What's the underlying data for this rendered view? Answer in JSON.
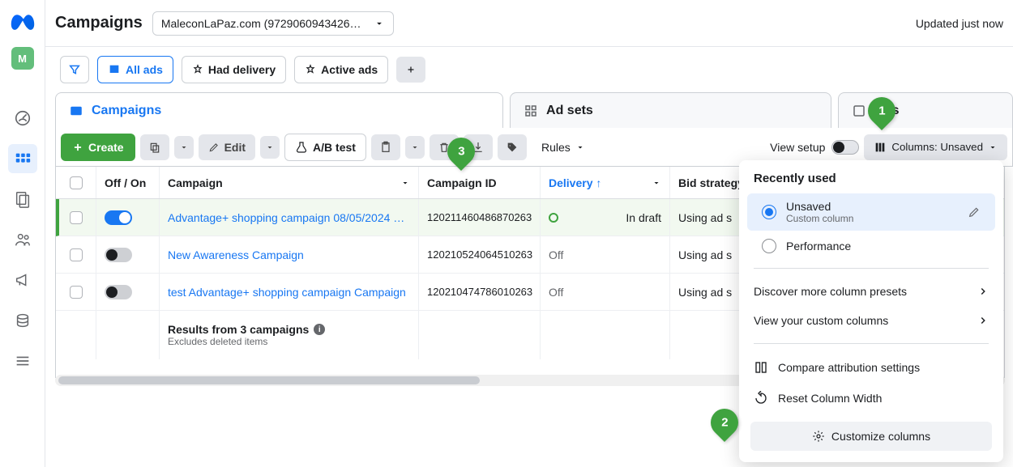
{
  "header": {
    "title": "Campaigns",
    "account": "MaleconLaPaz.com (9729060943426…",
    "updated": "Updated just now"
  },
  "avatar_letter": "M",
  "filters": {
    "all_ads": "All ads",
    "had_delivery": "Had delivery",
    "active_ads": "Active ads"
  },
  "tabs": {
    "campaigns": "Campaigns",
    "adsets": "Ad sets",
    "ads": "Ads"
  },
  "toolbar": {
    "create": "Create",
    "edit": "Edit",
    "abtest": "A/B test",
    "rules": "Rules",
    "view_setup": "View setup",
    "columns": "Columns: Unsaved"
  },
  "columns": {
    "onoff": "Off / On",
    "campaign": "Campaign",
    "campaign_id": "Campaign ID",
    "delivery": "Delivery",
    "bid": "Bid strategy"
  },
  "rows": [
    {
      "on": true,
      "name": "Advantage+ shopping campaign 08/05/2024 …",
      "id": "120211460486870263",
      "delivery": "In draft",
      "delivery_status": "draft",
      "bid": "Using ad s",
      "highlight": true
    },
    {
      "on": false,
      "name": "New Awareness Campaign",
      "id": "120210524064510263",
      "delivery": "Off",
      "delivery_status": "off",
      "bid": "Using ad s",
      "highlight": false
    },
    {
      "on": false,
      "name": "test Advantage+ shopping campaign Campaign",
      "id": "120210474786010263",
      "delivery": "Off",
      "delivery_status": "off",
      "bid": "Using ad s",
      "highlight": false
    }
  ],
  "summary": {
    "title": "Results from 3 campaigns",
    "sub": "Excludes deleted items"
  },
  "popover": {
    "recently": "Recently used",
    "unsaved": "Unsaved",
    "unsaved_sub": "Custom column",
    "performance": "Performance",
    "discover": "Discover more column presets",
    "view_custom": "View your custom columns",
    "compare": "Compare attribution settings",
    "reset": "Reset Column Width",
    "customize": "Customize columns"
  },
  "callouts": {
    "one": "1",
    "two": "2",
    "three": "3"
  }
}
